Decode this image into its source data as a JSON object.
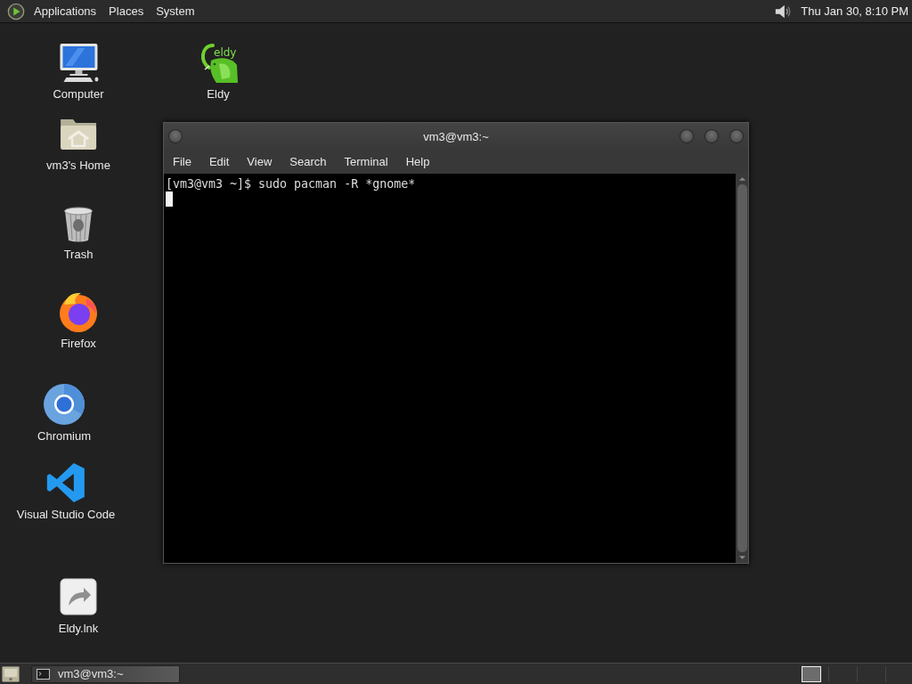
{
  "top_panel": {
    "menus": [
      "Applications",
      "Places",
      "System"
    ],
    "clock": "Thu Jan 30, 8:10 PM"
  },
  "desktop_icons": [
    {
      "kind": "computer",
      "label": "Computer"
    },
    {
      "kind": "eldy",
      "label": "Eldy",
      "logo_text": "eldy"
    },
    {
      "kind": "home",
      "label": "vm3's Home"
    },
    {
      "kind": "trash",
      "label": "Trash"
    },
    {
      "kind": "firefox",
      "label": "Firefox"
    },
    {
      "kind": "chromium",
      "label": "Chromium"
    },
    {
      "kind": "vscode",
      "label": "Visual Studio Code"
    },
    {
      "kind": "shortcut",
      "label": "Eldy.lnk"
    }
  ],
  "terminal_window": {
    "title": "vm3@vm3:~",
    "menus": [
      "File",
      "Edit",
      "View",
      "Search",
      "Terminal",
      "Help"
    ],
    "lines": [
      "[vm3@vm3 ~]$ sudo pacman -R *gnome*"
    ]
  },
  "bottom_panel": {
    "tasks": [
      {
        "label": "vm3@vm3:~",
        "selected": true
      }
    ],
    "workspaces": [
      {
        "selected": true
      },
      {
        "selected": false
      },
      {
        "selected": false
      },
      {
        "selected": false
      }
    ]
  }
}
